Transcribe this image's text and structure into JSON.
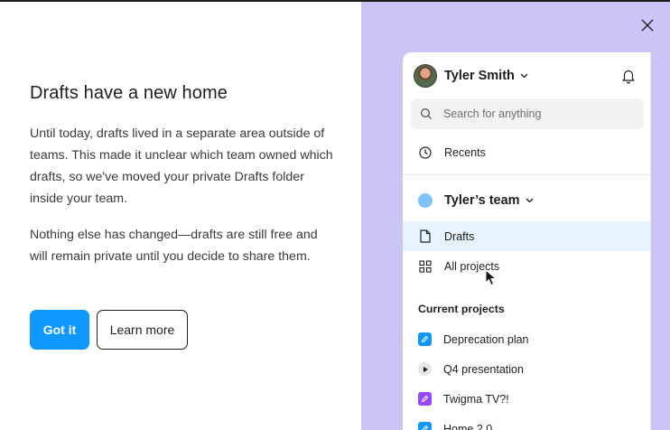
{
  "dialog": {
    "headline": "Drafts have a new home",
    "paragraph1": "Until today, drafts lived in a separate area outside of teams. This made it unclear which team owned which drafts, so we've moved your private Drafts folder inside your team.",
    "paragraph2": "Nothing else has changed—drafts are still free and will remain private until you decide to share them.",
    "primary_button": "Got it",
    "secondary_button": "Learn more"
  },
  "sidebar": {
    "user_name": "Tyler Smith",
    "search_placeholder": "Search for anything",
    "recents_label": "Recents",
    "team_name": "Tyler’s team",
    "team_items": [
      {
        "label": "Drafts",
        "icon": "file-icon",
        "selected": true
      },
      {
        "label": "All projects",
        "icon": "grid-icon",
        "selected": false
      }
    ],
    "section_title": "Current projects",
    "projects": [
      {
        "label": "Deprecation plan",
        "icon": "pen-badge-icon",
        "color": "#0d99ff"
      },
      {
        "label": "Q4 presentation",
        "icon": "play-badge-icon",
        "color": "#e6e6e6"
      },
      {
        "label": "Twigma TV?!",
        "icon": "pen-badge-icon",
        "color": "#9747ff"
      },
      {
        "label": "Home 2.0",
        "icon": "pen-badge-icon",
        "color": "#0d99ff"
      }
    ]
  },
  "colors": {
    "accent": "#0d99ff",
    "illustration_bg": "#cac5f5",
    "selected_row": "#e5f4ff",
    "team_dot": "#7cc4fa"
  }
}
